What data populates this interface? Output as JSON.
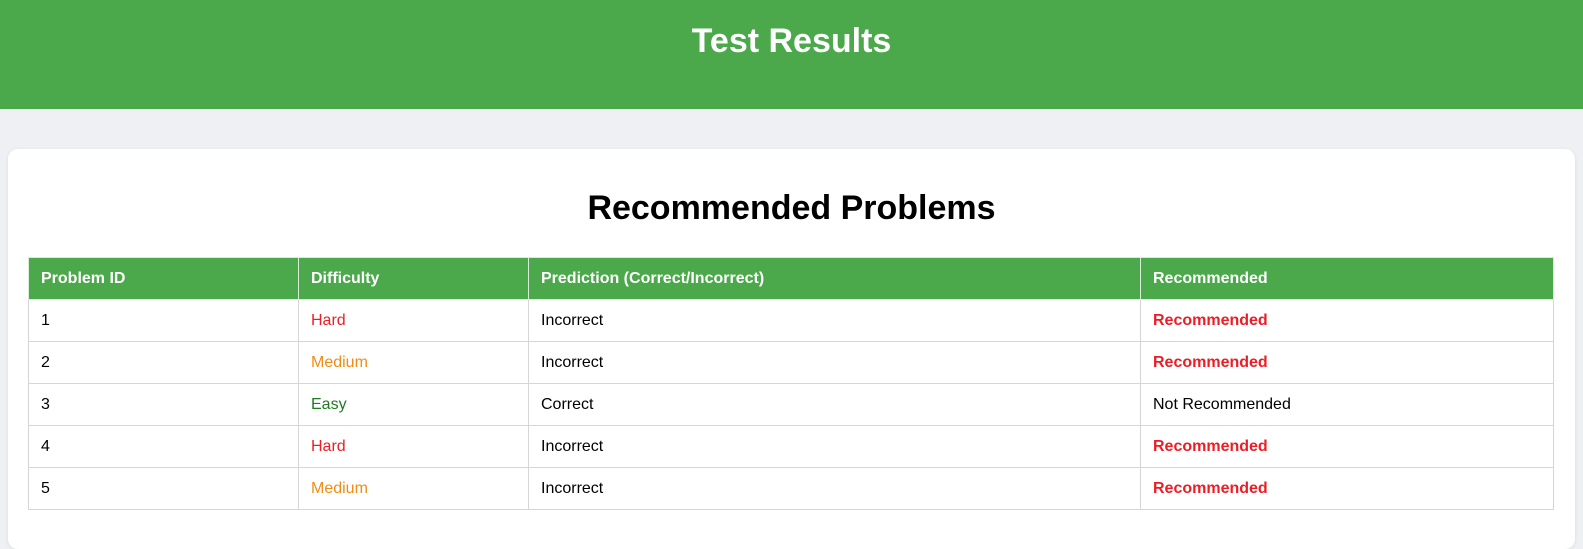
{
  "header": {
    "title": "Test Results"
  },
  "section": {
    "title": "Recommended Problems"
  },
  "table": {
    "columns": [
      "Problem ID",
      "Difficulty",
      "Prediction (Correct/Incorrect)",
      "Recommended"
    ],
    "rows": [
      {
        "id": "1",
        "difficulty": "Hard",
        "prediction": "Incorrect",
        "recommended": "Recommended"
      },
      {
        "id": "2",
        "difficulty": "Medium",
        "prediction": "Incorrect",
        "recommended": "Recommended"
      },
      {
        "id": "3",
        "difficulty": "Easy",
        "prediction": "Correct",
        "recommended": "Not Recommended"
      },
      {
        "id": "4",
        "difficulty": "Hard",
        "prediction": "Incorrect",
        "recommended": "Recommended"
      },
      {
        "id": "5",
        "difficulty": "Medium",
        "prediction": "Incorrect",
        "recommended": "Recommended"
      }
    ]
  },
  "colors": {
    "header_bg": "#4ba84b",
    "hard": "#ee1c25",
    "medium": "#f28c12",
    "easy": "#1e7b1e",
    "recommended": "#ee1c25"
  }
}
